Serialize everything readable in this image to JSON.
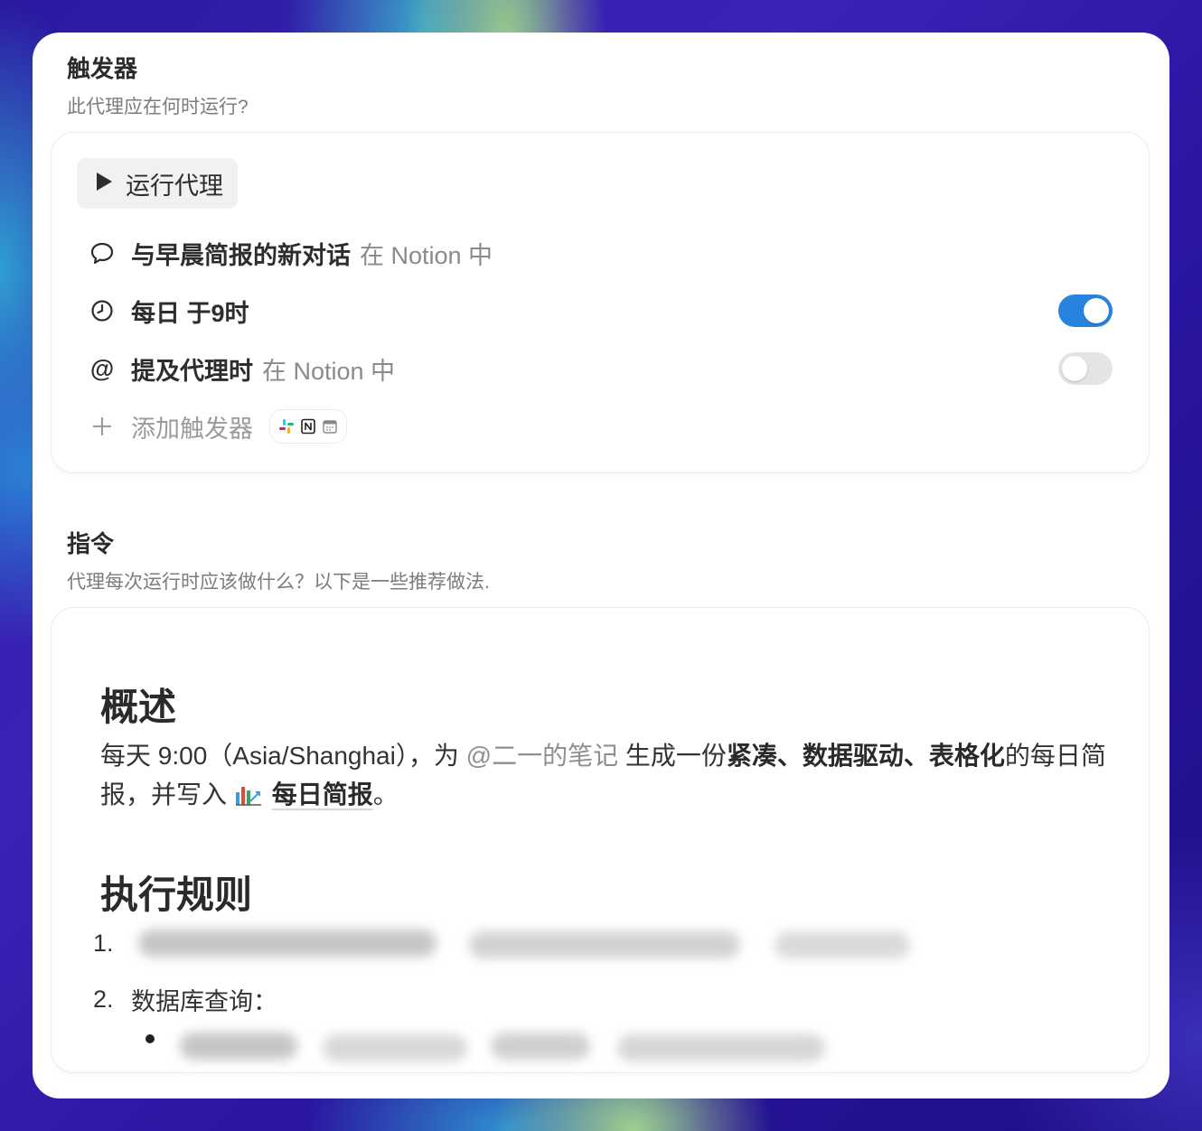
{
  "trigger": {
    "title": "触发器",
    "subtitle": "此代理应在何时运行?",
    "run_button": "运行代理",
    "rows": [
      {
        "icon": "chat-bubble-icon",
        "label": "与早晨简报的新对话",
        "suffix": "在 Notion 中"
      },
      {
        "icon": "clock-icon",
        "label": "每日 于9时",
        "suffix": "",
        "toggle": true
      },
      {
        "icon": "at-sign-icon",
        "label": "提及代理时",
        "suffix": "在 Notion 中",
        "toggle": false
      }
    ],
    "add_label": "添加触发器"
  },
  "instructions": {
    "title": "指令",
    "subtitle": "代理每次运行时应该做什么？以下是一些推荐做法."
  },
  "document": {
    "overview_heading": "概述",
    "overview": {
      "part1": "每天 9:00（Asia/Shanghai），为 ",
      "mention": "@二一的笔记",
      "part2": " 生成一份",
      "bold1": "紧凑、数据驱动、表格化",
      "part3": "的每日简报，并写入 ",
      "page_link": "每日简报",
      "part4": "。"
    },
    "rules_heading": "执行规则",
    "rules": [
      {
        "num": "1.",
        "text": ""
      },
      {
        "num": "2.",
        "text": "数据库查询："
      }
    ]
  },
  "colors": {
    "toggle_on": "#2783de",
    "toggle_off": "#e4e4e2",
    "muted_text": "#7c7c7c"
  }
}
